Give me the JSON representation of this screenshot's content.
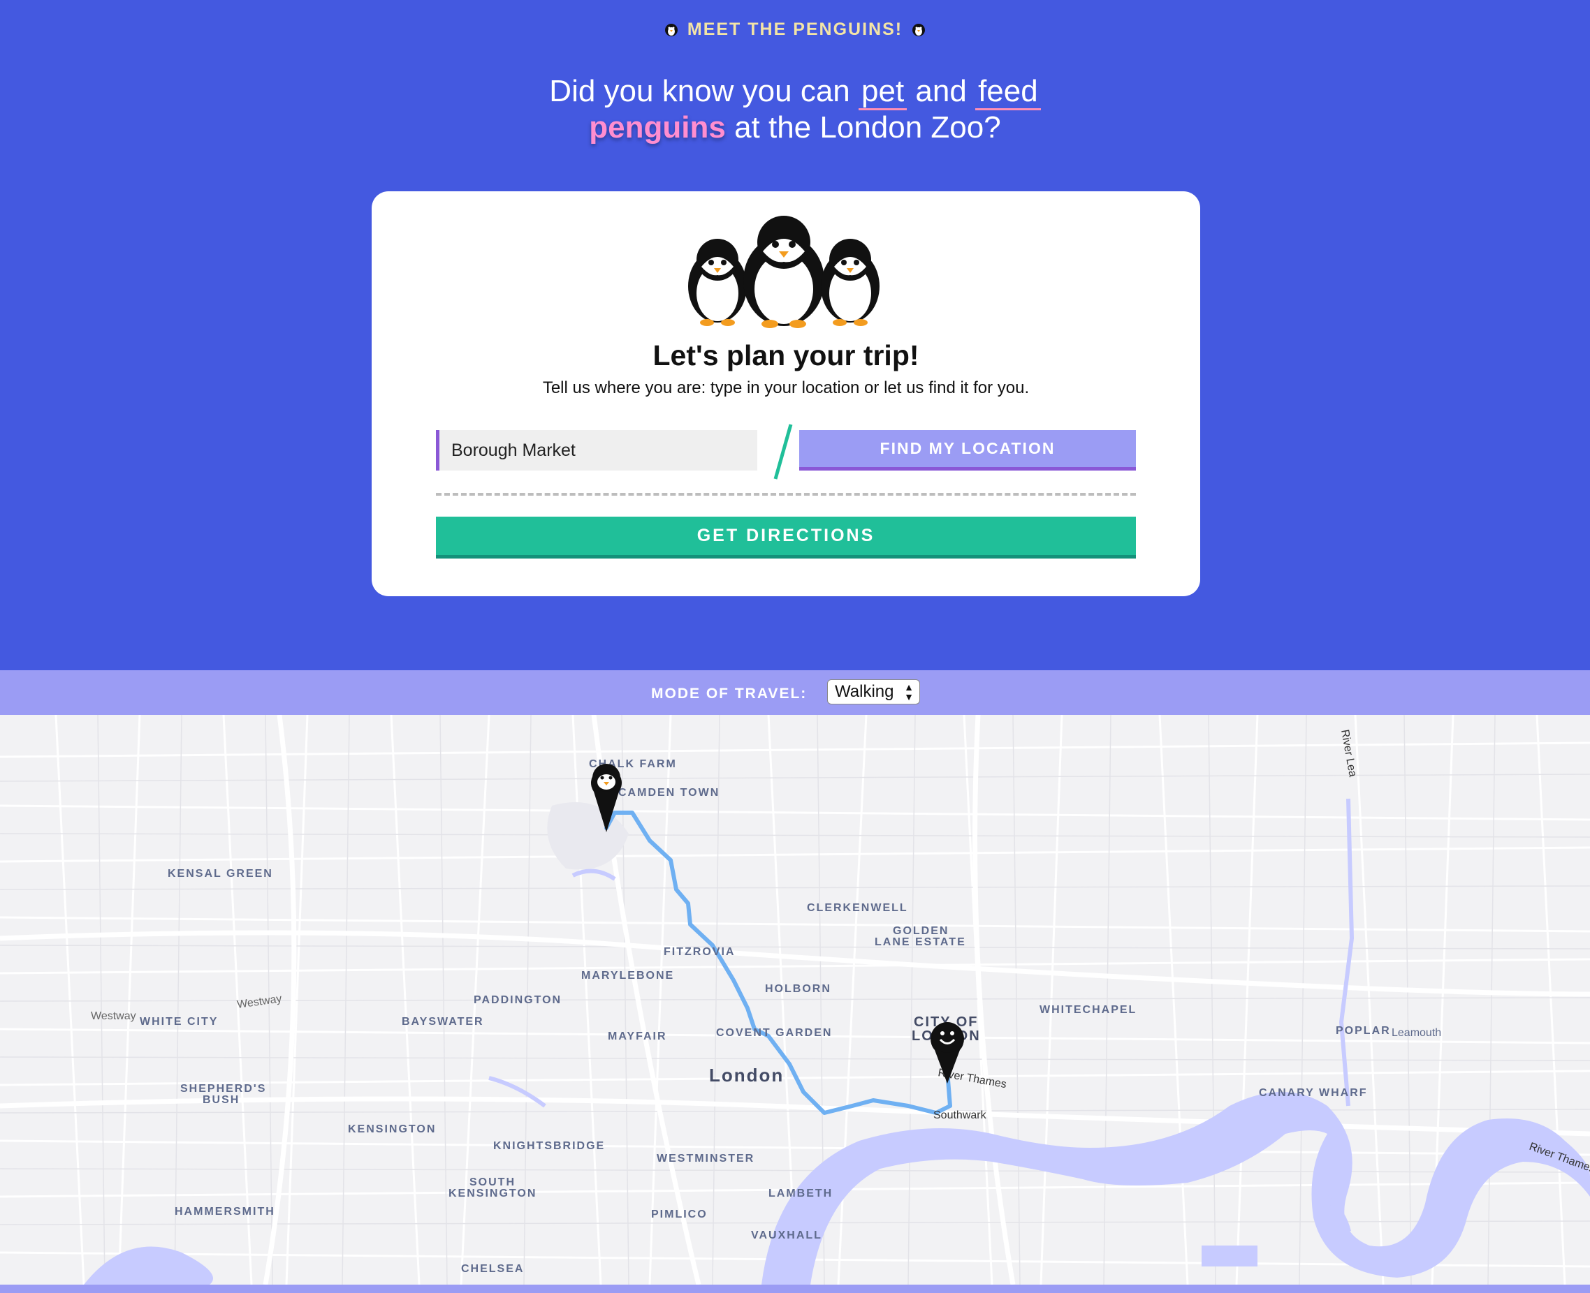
{
  "header": {
    "kicker": "MEET THE PENGUINS!",
    "headline_pre": "Did you know you can",
    "headline_pet": "pet",
    "headline_and": "and",
    "headline_feed": "feed",
    "headline_penguins": "penguins",
    "headline_post": "at the London Zoo?"
  },
  "card": {
    "title": "Let's plan your trip!",
    "subtitle": "Tell us where you are: type in your location or let us find it for you.",
    "location_value": "Borough Market",
    "find_location_label": "FIND MY LOCATION",
    "get_directions_label": "GET DIRECTIONS"
  },
  "mode_bar": {
    "label": "MODE OF TRAVEL:",
    "selected": "Walking"
  },
  "map": {
    "place_labels": [
      "CHALK FARM",
      "CAMDEN TOWN",
      "KENSAL GREEN",
      "CLERKENWELL",
      "GOLDEN",
      "LANE ESTATE",
      "FITZROVIA",
      "MARYLEBONE",
      "HOLBORN",
      "PADDINGTON",
      "WHITE CITY",
      "BAYSWATER",
      "MAYFAIR",
      "COVENT GARDEN",
      "London",
      "CITY OF",
      "LONDON",
      "WHITECHAPEL",
      "POPLAR",
      "Leamouth",
      "SHEPHERD'S",
      "BUSH",
      "KENSINGTON",
      "KNIGHTSBRIDGE",
      "WESTMINSTER",
      "SOUTH",
      "KENSINGTON",
      "LAMBETH",
      "HAMMERSMITH",
      "PIMLICO",
      "VAUXHALL",
      "CHELSEA",
      "Southwark",
      "CANARY WHARF",
      "River Thames",
      "River Thames",
      "River Lea",
      "Westway",
      "Westway"
    ],
    "colors": {
      "background": "#f2f2f4",
      "roads": "#ffffff",
      "water": "#c7cbff",
      "route": "#6fb0f2"
    },
    "markers": [
      "penguin-start-marker",
      "smiley-destination-marker"
    ]
  }
}
